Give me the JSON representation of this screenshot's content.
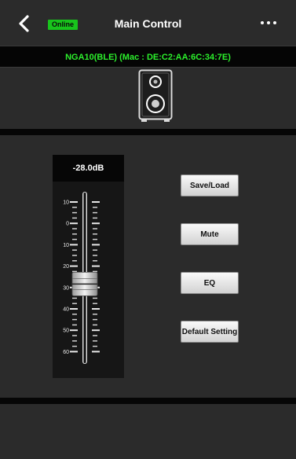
{
  "header": {
    "title": "Main Control",
    "status_badge": "Online",
    "status_color": "#18c41c",
    "back_icon": "chevron-left-icon",
    "menu_icon": "more-horizontal-icon"
  },
  "device": {
    "name": "NGA10(BLE) (Mac : DE:C2:AA:6C:34:7E)",
    "name_color": "#2cf02c",
    "icon": "speaker-icon"
  },
  "volume": {
    "readout": "-28.0dB",
    "value_db": -28.0,
    "scale_labels": [
      "10",
      "0",
      "10",
      "20",
      "30",
      "40",
      "50",
      "60"
    ]
  },
  "buttons": {
    "save_load": "Save/Load",
    "mute": "Mute",
    "eq": "EQ",
    "default_setting": "Default Setting"
  }
}
